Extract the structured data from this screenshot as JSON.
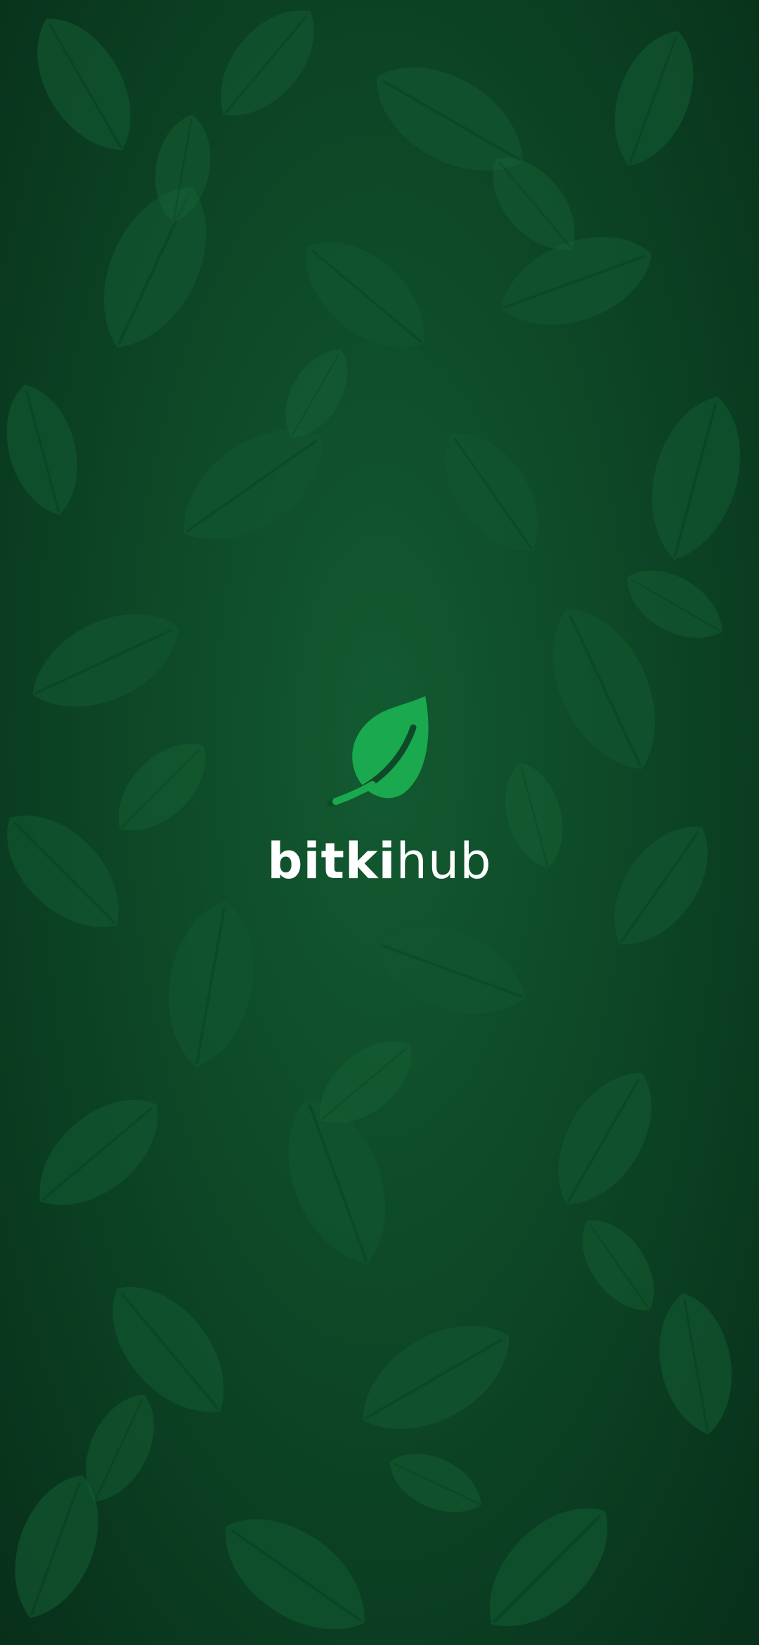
{
  "splash": {
    "brand_primary": "bitki",
    "brand_secondary": "hub",
    "logo_icon": "leaf-icon",
    "background": "leaf-foliage-pattern"
  },
  "colors": {
    "background": "#0b3f22",
    "leaf_dark": "#0f4a28",
    "leaf_light": "#176436",
    "accent": "#1aa94e",
    "text": "#ffffff"
  }
}
